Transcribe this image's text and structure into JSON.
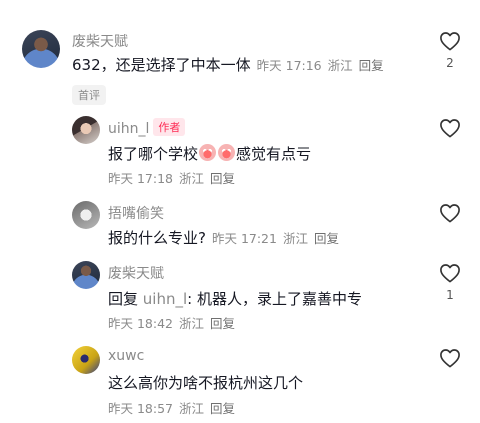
{
  "comments": [
    {
      "name": "废柴天赋",
      "text": "632，还是选择了中本一体",
      "time": "昨天 17:16",
      "location": "浙江",
      "reply_label": "回复",
      "likes": "2",
      "tag": "首评"
    }
  ],
  "replies": [
    {
      "name": "uihn_l",
      "badge": "作者",
      "text_before": "报了哪个学校",
      "text_after": "感觉有点亏",
      "emojis": [
        "scream-face-emoji",
        "scream-face-emoji"
      ],
      "time": "昨天 17:18",
      "location": "浙江",
      "reply_label": "回复",
      "likes": ""
    },
    {
      "name": "捂嘴偷笑",
      "text": "报的什么专业?",
      "time": "昨天 17:21",
      "location": "浙江",
      "reply_label": "回复",
      "likes": ""
    },
    {
      "name": "废柴天赋",
      "reply_prefix": "回复",
      "reply_target": "uihn_l",
      "text": ": 机器人，录上了嘉善中专",
      "time": "昨天 18:42",
      "location": "浙江",
      "reply_label": "回复",
      "likes": "1"
    },
    {
      "name": "xuwc",
      "text": "这么高你为啥不报杭州这几个",
      "time": "昨天 18:57",
      "location": "浙江",
      "reply_label": "回复",
      "likes": ""
    }
  ],
  "icons": {
    "like": "heart-outline-icon"
  }
}
